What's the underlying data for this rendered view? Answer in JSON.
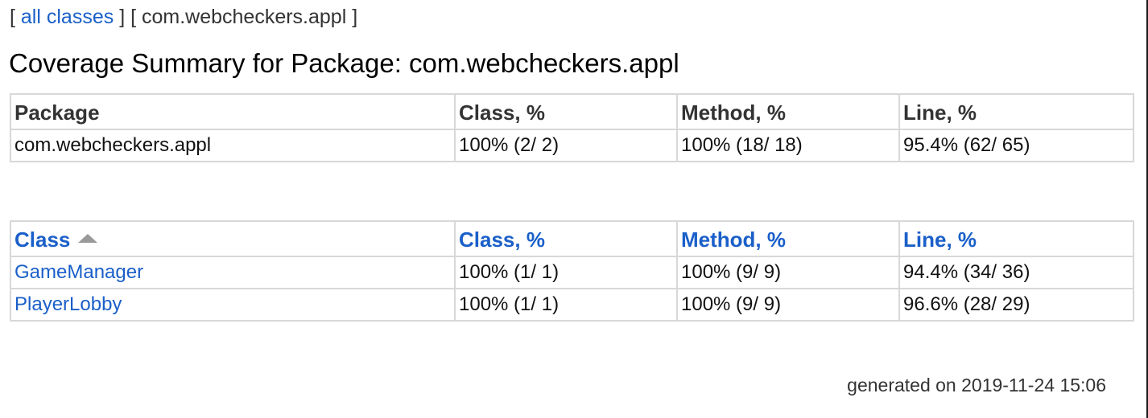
{
  "breadcrumb": {
    "open_bracket": "[",
    "all_classes_link": "all classes",
    "separator": "] [",
    "current_package": "com.webcheckers.appl",
    "close_bracket": "]"
  },
  "title": "Coverage Summary for Package: com.webcheckers.appl",
  "package_table": {
    "headers": [
      "Package",
      "Class, %",
      "Method, %",
      "Line, %"
    ],
    "rows": [
      [
        "com.webcheckers.appl",
        "100% (2/ 2)",
        "100% (18/ 18)",
        "95.4% (62/ 65)"
      ]
    ]
  },
  "class_table": {
    "headers": [
      "Class",
      "Class, %",
      "Method, %",
      "Line, %"
    ],
    "sort_indicator": "sort-ascending-icon",
    "rows": [
      [
        "GameManager",
        "100% (1/ 1)",
        "100% (9/ 9)",
        "94.4% (34/ 36)"
      ],
      [
        "PlayerLobby",
        "100% (1/ 1)",
        "100% (9/ 9)",
        "96.6% (28/ 29)"
      ]
    ]
  },
  "footer": "generated on 2019-11-24 15:06",
  "colors": {
    "link": "#1a5fc9",
    "border": "#d8d8d8",
    "header_text": "#333333"
  }
}
